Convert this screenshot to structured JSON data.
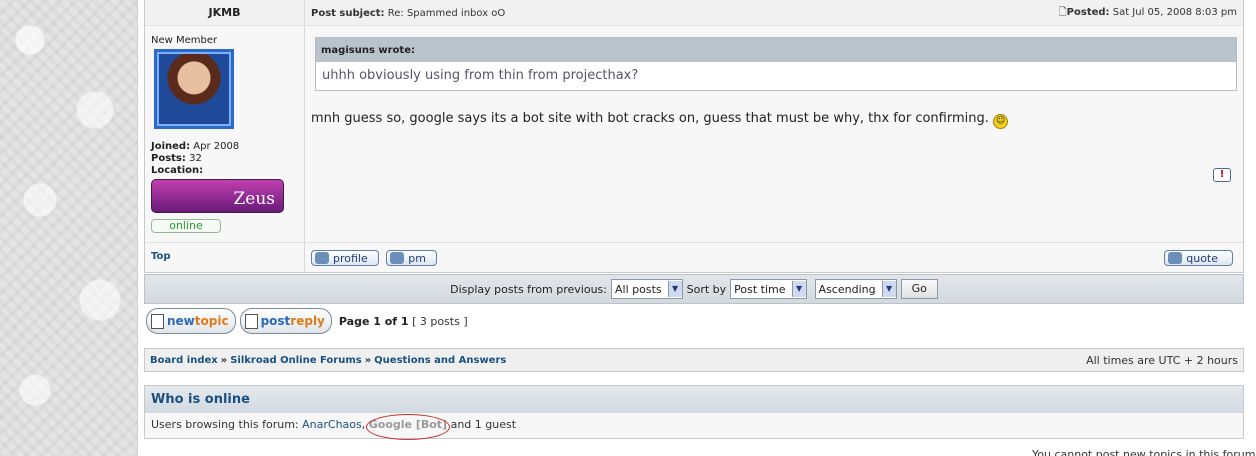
{
  "post": {
    "author": "JKMB",
    "subject_label": "Post subject:",
    "subject": "Re: Spammed inbox oO",
    "posted_label": "Posted:",
    "posted": "Sat Jul 05, 2008 8:03 pm",
    "rank": "New Member",
    "joined_label": "Joined:",
    "joined": "Apr 2008",
    "posts_label": "Posts:",
    "posts": "32",
    "location_label": "Location:",
    "badge_text": "Zeus",
    "online": "online",
    "quote_author": "magisuns wrote:",
    "quote_text": "uhhh obviously using from thin from projecthax?",
    "message": "mnh guess so, google says its a bot site with bot cracks on, guess that must be why, thx for confirming.",
    "top": "Top",
    "buttons": {
      "profile": "profile",
      "pm": "pm",
      "quote": "quote"
    }
  },
  "display": {
    "label_prev": "Display posts from previous:",
    "prev_value": "All posts",
    "sort_label": "Sort by",
    "sort_value": "Post time",
    "order_value": "Ascending",
    "go": "Go"
  },
  "actions": {
    "new_a": "new",
    "new_b": "topic",
    "reply_a": "post",
    "reply_b": "reply",
    "page": "Page 1 of 1",
    "count": "[ 3 posts ]"
  },
  "breadcrumb": {
    "items": [
      "Board index",
      "Silkroad Online Forums",
      "Questions and Answers"
    ],
    "sep": "»",
    "timezone": "All times are UTC + 2 hours"
  },
  "who_online": {
    "title": "Who is online",
    "prefix": "Users browsing this forum:",
    "user1": "AnarChaos",
    "bot": "Google [Bot]",
    "suffix": "and 1 guest"
  },
  "footer": {
    "cutoff": "You cannot post new topics in this forum"
  }
}
